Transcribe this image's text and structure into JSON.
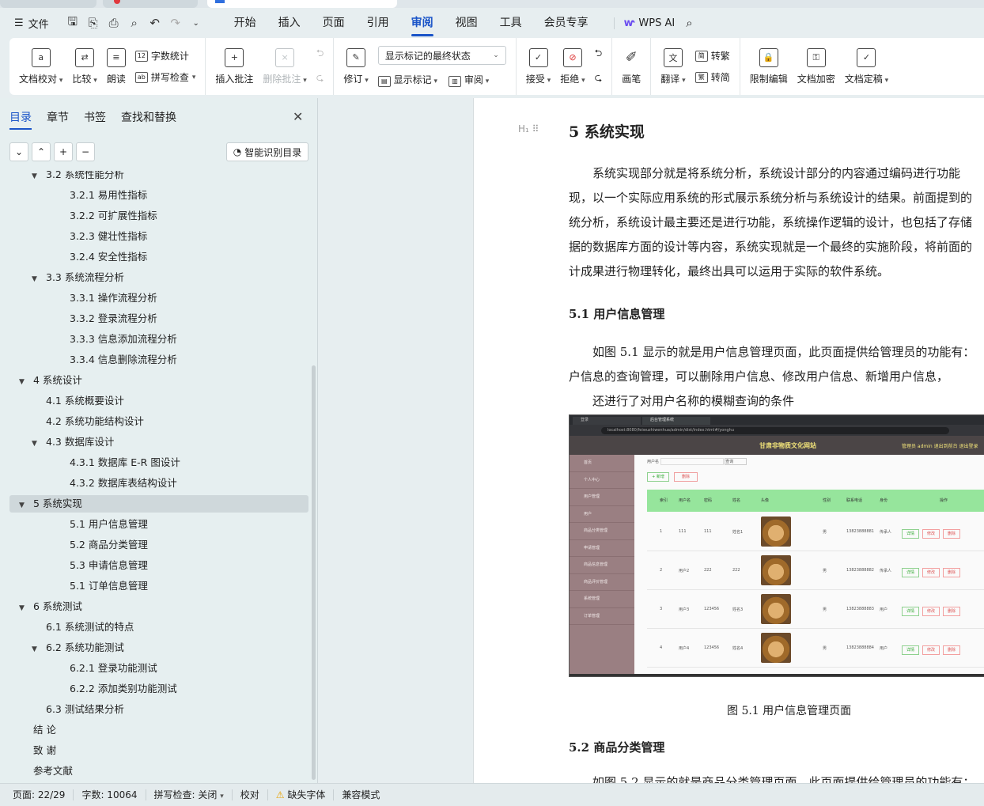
{
  "menubar": {
    "file_label": "文件",
    "tabs": [
      "开始",
      "插入",
      "页面",
      "引用",
      "审阅",
      "视图",
      "工具",
      "会员专享"
    ],
    "active_tab": "审阅",
    "wps_ai_label": "WPS AI"
  },
  "ribbon": {
    "doc_check": "文档校对",
    "compare": "比较",
    "read_aloud": "朗读",
    "word_count": "字数统计",
    "spell_check": "拼写检查",
    "insert_comment": "插入批注",
    "delete_comment": "删除批注",
    "revise": "修订",
    "markup_mode": "显示标记的最终状态",
    "show_markup": "显示标记",
    "review": "审阅",
    "accept": "接受",
    "reject": "拒绝",
    "pen": "画笔",
    "translate": "翻译",
    "to_traditional": "转繁",
    "to_simplified": "转简",
    "restrict_edit": "限制编辑",
    "doc_encrypt": "文档加密",
    "doc_finalize": "文档定稿"
  },
  "nav": {
    "tabs": [
      "目录",
      "章节",
      "书签",
      "查找和替换"
    ],
    "smart_toc": "智能识别目录",
    "toc": [
      {
        "text": "3.2  系统性能分析",
        "indent": 2,
        "tw": "▼"
      },
      {
        "text": "3.2.1  易用性指标",
        "indent": 3,
        "tw": ""
      },
      {
        "text": "3.2.2  可扩展性指标",
        "indent": 3,
        "tw": ""
      },
      {
        "text": "3.2.3  健壮性指标",
        "indent": 3,
        "tw": ""
      },
      {
        "text": "3.2.4  安全性指标",
        "indent": 3,
        "tw": ""
      },
      {
        "text": "3.3  系统流程分析",
        "indent": 2,
        "tw": "▼"
      },
      {
        "text": "3.3.1  操作流程分析",
        "indent": 3,
        "tw": ""
      },
      {
        "text": "3.3.2  登录流程分析",
        "indent": 3,
        "tw": ""
      },
      {
        "text": "3.3.3  信息添加流程分析",
        "indent": 3,
        "tw": ""
      },
      {
        "text": "3.3.4  信息删除流程分析",
        "indent": 3,
        "tw": ""
      },
      {
        "text": "4  系统设计",
        "indent": 1,
        "tw": "▼"
      },
      {
        "text": "4.1  系统概要设计",
        "indent": 2,
        "tw": ""
      },
      {
        "text": "4.2  系统功能结构设计",
        "indent": 2,
        "tw": ""
      },
      {
        "text": "4.3  数据库设计",
        "indent": 2,
        "tw": "▼"
      },
      {
        "text": "4.3.1  数据库 E-R 图设计",
        "indent": 3,
        "tw": ""
      },
      {
        "text": "4.3.2  数据库表结构设计",
        "indent": 3,
        "tw": ""
      },
      {
        "text": "5  系统实现",
        "indent": 1,
        "tw": "▼",
        "selected": true
      },
      {
        "text": "5.1 用户信息管理",
        "indent": 3,
        "tw": ""
      },
      {
        "text": "5.2  商品分类管理",
        "indent": 3,
        "tw": ""
      },
      {
        "text": "5.3 申请信息管理",
        "indent": 3,
        "tw": ""
      },
      {
        "text": "5.1 订单信息管理",
        "indent": 3,
        "tw": ""
      },
      {
        "text": "6  系统测试",
        "indent": 1,
        "tw": "▼"
      },
      {
        "text": "6.1  系统测试的特点",
        "indent": 2,
        "tw": ""
      },
      {
        "text": "6.2  系统功能测试",
        "indent": 2,
        "tw": "▼"
      },
      {
        "text": "6.2.1  登录功能测试",
        "indent": 3,
        "tw": ""
      },
      {
        "text": "6.2.2  添加类别功能测试",
        "indent": 3,
        "tw": ""
      },
      {
        "text": "6.3  测试结果分析",
        "indent": 2,
        "tw": ""
      },
      {
        "text": "结   论",
        "indent": 1,
        "tw": ""
      },
      {
        "text": "致   谢",
        "indent": 1,
        "tw": ""
      },
      {
        "text": "参考文献",
        "indent": 1,
        "tw": ""
      }
    ]
  },
  "doc": {
    "h1": "5  系统实现",
    "p1": [
      "　　系统实现部分就是将系统分析，系统设计部分的内容通过编码进行功能",
      "现，以一个实际应用系统的形式展示系统分析与系统设计的结果。前面提到的",
      "统分析，系统设计最主要还是进行功能，系统操作逻辑的设计，也包括了存储",
      "据的数据库方面的设计等内容，系统实现就是一个最终的实施阶段，将前面的",
      "计成果进行物理转化，最终出具可以运用于实际的软件系统。"
    ],
    "h2a": "5.1 用户信息管理",
    "p2": [
      "　　如图 5.1 显示的就是用户信息管理页面，此页面提供给管理员的功能有：",
      "户信息的查询管理，可以删除用户信息、修改用户信息、新增用户信息，",
      "　　还进行了对用户名称的模糊查询的条件"
    ],
    "caption": "图 5.1  用户信息管理页面",
    "h2b": "5.2  商品分类管理",
    "p3": "　　如图 5.2 显示的就是商品分类管理页面，此页面提供给管理员的功能有："
  },
  "screenshot": {
    "tab1": "登录",
    "tab2": "后台管理系统",
    "url": "localhost:8080/feiwuzhiwenhua/admin/dist/index.html#/yonghu",
    "site_title": "甘肃非物质文化网站",
    "header_right": "管理员 admin    退出到前台    退出登录",
    "sidebar": [
      "首页",
      "个人中心",
      "用户管理",
      "用户",
      "商品分类管理",
      "申请管理",
      "商品信息管理",
      "商品评价管理",
      "系统管理",
      "订单管理"
    ],
    "search_label": "用户名",
    "search_placeholder": "用户名",
    "search_btn": "查询",
    "add_btn": "+ 新增",
    "del_btn": "删除",
    "columns": [
      "索引",
      "用户名",
      "密码",
      "姓名",
      "头像",
      "性别",
      "联系电话",
      "身份",
      "操作"
    ],
    "rows": [
      {
        "idx": "1",
        "user": "111",
        "pwd": "111",
        "name": "姓名1",
        "sex": "男",
        "phone": "13823888881",
        "role": "传承人"
      },
      {
        "idx": "2",
        "user": "用户2",
        "pwd": "222",
        "name": "222",
        "sex": "男",
        "phone": "13823888882",
        "role": "传承人"
      },
      {
        "idx": "3",
        "user": "用户3",
        "pwd": "123456",
        "name": "姓名3",
        "sex": "男",
        "phone": "13823888883",
        "role": "用户"
      },
      {
        "idx": "4",
        "user": "用户4",
        "pwd": "123456",
        "name": "姓名4",
        "sex": "男",
        "phone": "13823888884",
        "role": "用户"
      }
    ],
    "actions": [
      "详情",
      "修改",
      "删除"
    ]
  },
  "status": {
    "page": "页面: 22/29",
    "words": "字数: 10064",
    "spell": "拼写检查: 关闭",
    "proof": "校对",
    "missing_font": "缺失字体",
    "compat": "兼容模式"
  }
}
